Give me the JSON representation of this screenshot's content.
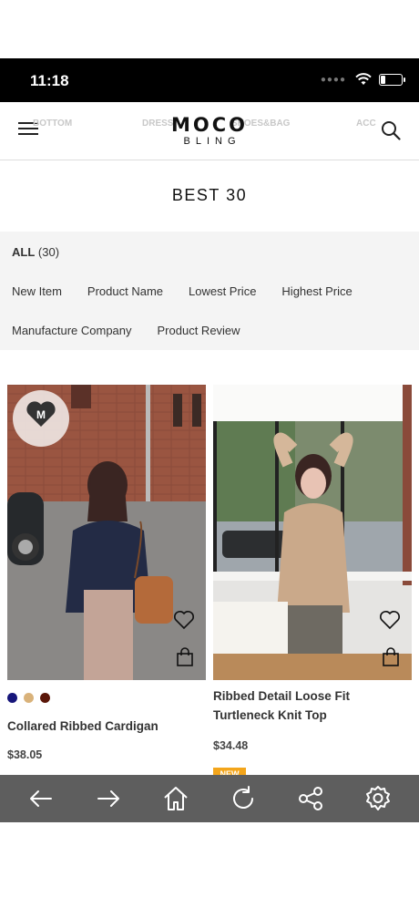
{
  "status_bar": {
    "time": "11:18",
    "signal_icon": "signal-dots-icon",
    "wifi_icon": "wifi-icon",
    "battery_icon": "battery-icon",
    "battery_level": 0.25
  },
  "header": {
    "menu_icon": "hamburger-menu-icon",
    "logo_top": "MOCO",
    "logo_bottom": "BLING",
    "search_icon": "search-icon",
    "ghost_nav": [
      "BOTTOM",
      "DRESS",
      "SHOES&BAG",
      "ACC"
    ]
  },
  "page": {
    "title": "BEST 30"
  },
  "filters": {
    "all_label": "ALL",
    "all_count": "(30)",
    "sort_row1": [
      "New Item",
      "Product Name",
      "Lowest Price",
      "Highest Price"
    ],
    "sort_row2": [
      "Manufacture Company",
      "Product Review"
    ]
  },
  "products": [
    {
      "name": "Collared Ribbed Cardigan",
      "price": "$38.05",
      "swatches": [
        "#16157a",
        "#d9b27a",
        "#5a1608"
      ],
      "badge_text_top": "I LOVE",
      "badge_text_bottom": "MOCO",
      "wish_icon": "heart-icon",
      "cart_icon": "shopping-bag-icon"
    },
    {
      "name": "Ribbed Detail Loose Fit Turtleneck Knit Top",
      "price": "$34.48",
      "tag": "NEW",
      "wish_icon": "heart-icon",
      "cart_icon": "shopping-bag-icon"
    }
  ],
  "bottom_bar": {
    "bg_color": "#5e5e5e",
    "buttons": [
      "back-arrow-icon",
      "forward-arrow-icon",
      "home-icon",
      "refresh-icon",
      "share-icon",
      "settings-gear-icon"
    ]
  },
  "colors": {
    "filter_bg": "#f4f4f4",
    "new_tag": "#f3a51b"
  }
}
